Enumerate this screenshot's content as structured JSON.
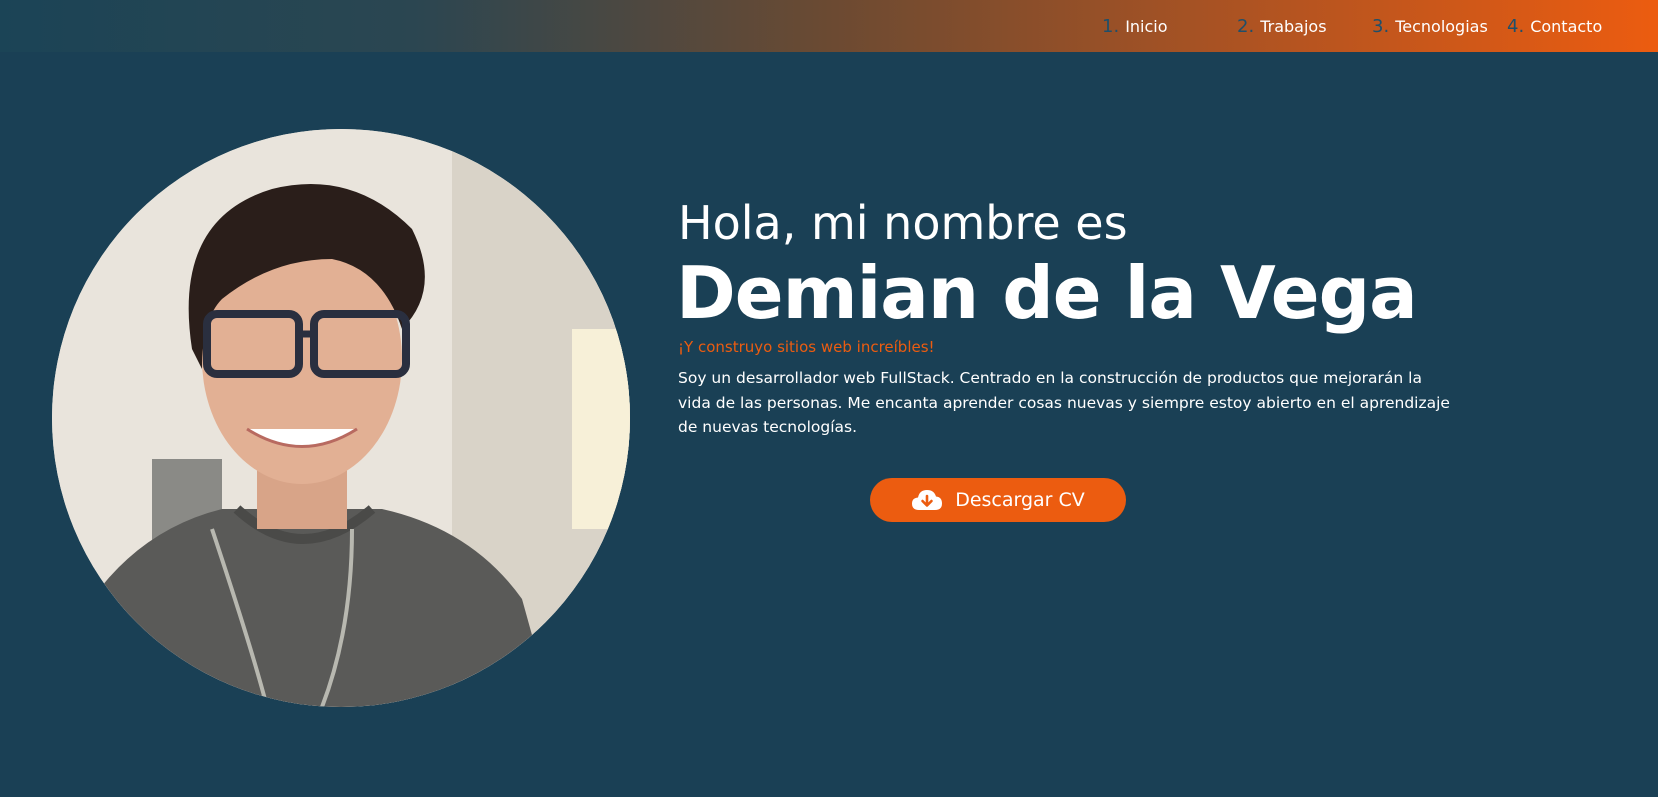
{
  "nav": {
    "items": [
      {
        "number": "1.",
        "label": "Inicio"
      },
      {
        "number": "2.",
        "label": "Trabajos"
      },
      {
        "number": "3.",
        "label": "Tecnologias"
      },
      {
        "number": "4.",
        "label": "Contacto"
      }
    ]
  },
  "hero": {
    "greeting": "Hola, mi nombre es",
    "name": "Demian de la Vega",
    "tagline": "¡Y construyo sitios web increíbles!",
    "bio": "Soy un desarrollador web FullStack. Centrado en la construcción de productos que mejorarán la vida de las personas. Me encanta aprender cosas nuevas y siempre estoy abierto en el aprendizaje de nuevas tecnologías.",
    "cv_button_label": "Descargar CV",
    "cv_button_icon": "cloud-download-icon"
  },
  "colors": {
    "background": "#1a4055",
    "accent": "#ec5c10",
    "nav_number": "#1f4f6a",
    "text": "#ffffff"
  }
}
